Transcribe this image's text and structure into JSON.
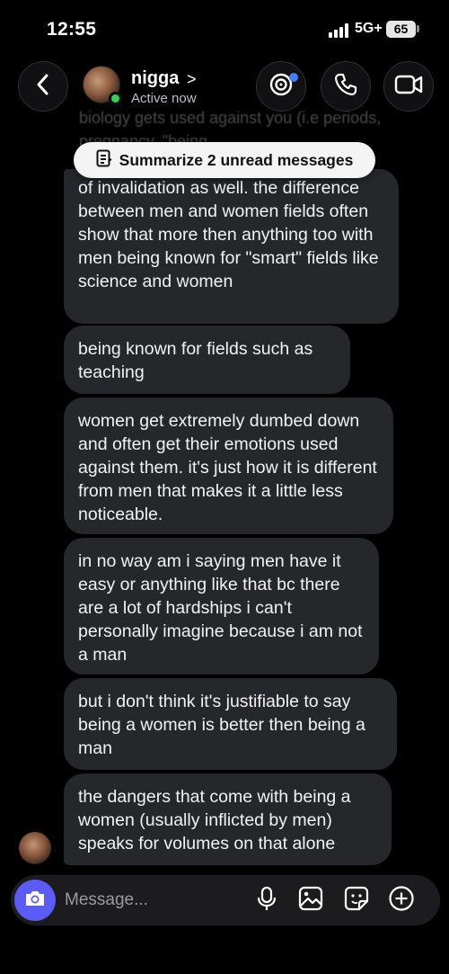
{
  "status_bar": {
    "time": "12:55",
    "network": "5G+",
    "battery": "65"
  },
  "header": {
    "contact_name": "nigga",
    "chevron": ">",
    "status": "Active now",
    "online_color": "#2fd158"
  },
  "thread": {
    "faded_previous_text": "biology gets used against you (i.e periods, pregnancy, \"being",
    "summarize_label": "Summarize 2 unread messages",
    "messages": [
      {
        "text": "of invalidation as well. the difference between men and women fields often show that more then anything too with men being known for \"smart\" fields like science and women"
      },
      {
        "text": "being known for fields such as teaching"
      },
      {
        "text": "women get extremely dumbed down and often get their emotions used against them. it's just how it is different from men that makes it a little less noticeable."
      },
      {
        "text": "in no way am i saying men have it easy or anything like that bc there are a lot of hardships i can't personally imagine because i am not a man"
      },
      {
        "text": "but i don't think it's justifiable to say being a women is better then being a man"
      },
      {
        "text": "the dangers that come with being a women (usually inflicted by men) speaks for volumes on that alone"
      }
    ]
  },
  "composer": {
    "placeholder": "Message...",
    "accent_color": "#5b5bf5"
  },
  "icons": {
    "back": "chevron-left-icon",
    "effects": "effects-icon",
    "call": "phone-icon",
    "video": "video-camera-icon",
    "summarize": "document-icon",
    "camera": "camera-icon",
    "mic": "microphone-icon",
    "gallery": "image-icon",
    "sticker": "sticker-icon",
    "add": "plus-circle-icon"
  }
}
